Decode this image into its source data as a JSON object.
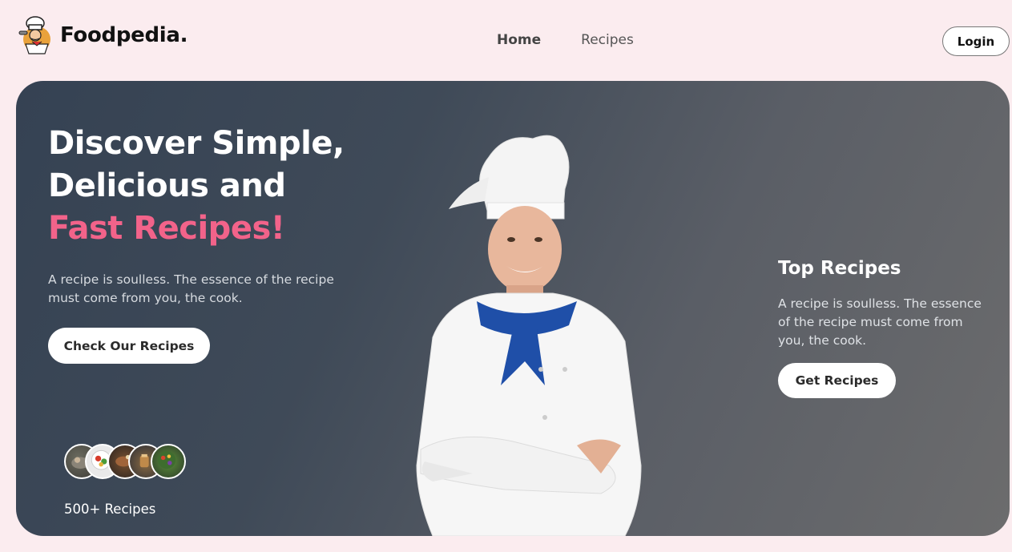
{
  "header": {
    "brand": "Foodpedia.",
    "logo_icon": "chef-mascot-icon",
    "nav": [
      {
        "label": "Home",
        "active": true
      },
      {
        "label": "Recipes",
        "active": false
      }
    ],
    "login_label": "Login"
  },
  "hero": {
    "title_line1": "Discover Simple,",
    "title_line2": "Delicious and",
    "title_highlight": "Fast Recipes!",
    "description": "A recipe is soulless. The essence of the recipe must come from you, the cook.",
    "cta_label": "Check Our Recipes",
    "recipes_count": "500+ Recipes",
    "image": "chef-photo",
    "top_recipes": {
      "title": "Top Recipes",
      "description": "A recipe is soulless. The essence of the recipe must come from you, the cook.",
      "cta_label": "Get Recipes"
    }
  },
  "colors": {
    "accent": "#f2638a",
    "page_bg": "#fbecef",
    "hero_bg_start": "#354253",
    "hero_bg_end": "#6c6c6d"
  }
}
